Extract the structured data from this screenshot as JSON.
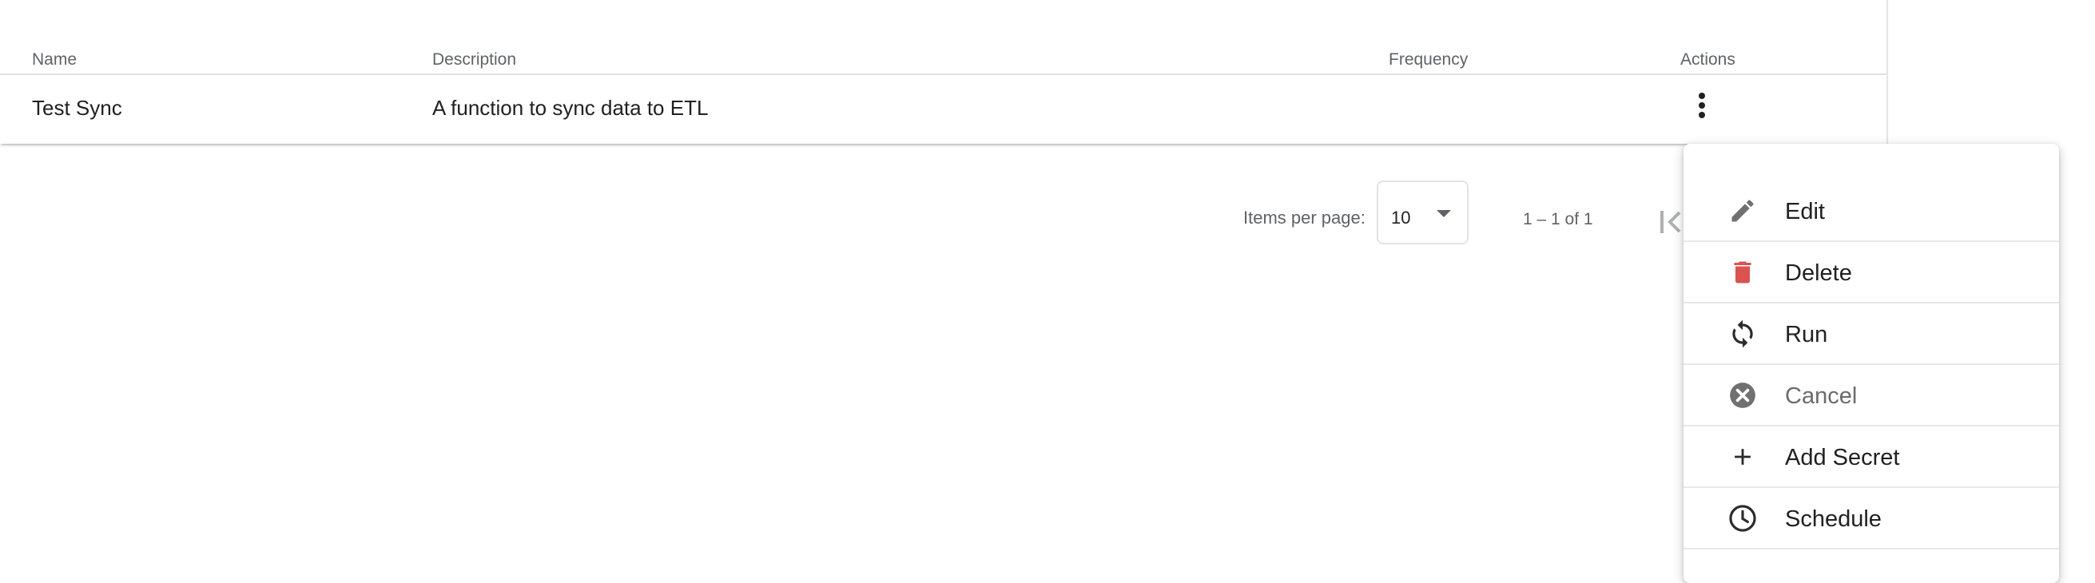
{
  "table": {
    "columns": {
      "name": "Name",
      "description": "Description",
      "frequency": "Frequency",
      "actions": "Actions"
    },
    "rows": [
      {
        "name": "Test Sync",
        "description": "A function to sync data to ETL",
        "frequency": "",
        "actions_icon": "more-vert-icon"
      }
    ]
  },
  "paginator": {
    "items_per_page_label": "Items per page:",
    "page_size": "10",
    "range_label": "1 – 1 of 1"
  },
  "menu": {
    "items": [
      {
        "label": "Edit",
        "icon": "pencil-icon",
        "color": "#707070"
      },
      {
        "label": "Delete",
        "icon": "trash-icon",
        "color": "#d9534f"
      },
      {
        "label": "Run",
        "icon": "sync-icon",
        "color": "#2b2b2b"
      },
      {
        "label": "Cancel",
        "icon": "cancel-circle-icon",
        "color": "#707070",
        "disabled": true
      },
      {
        "label": "Add Secret",
        "icon": "plus-icon",
        "color": "#2b2b2b"
      },
      {
        "label": "Schedule",
        "icon": "clock-icon",
        "color": "#2b2b2b"
      }
    ]
  }
}
